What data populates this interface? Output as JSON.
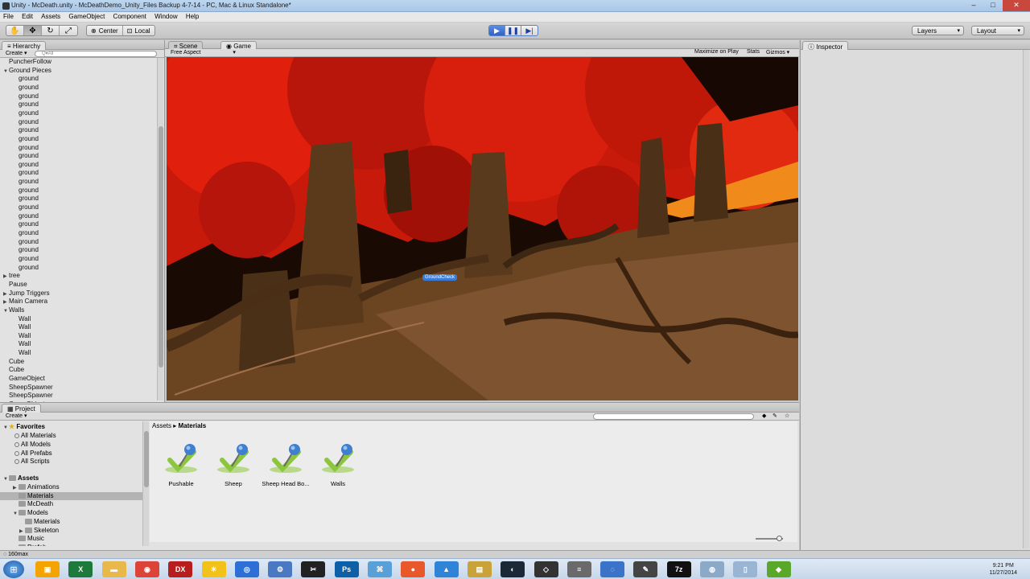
{
  "window": {
    "title": "Unity - McDeath.unity - McDeathDemo_Unity_Files Backup 4-7-14 - PC, Mac & Linux Standalone*",
    "minimize": "–",
    "maximize": "□",
    "close": "✕"
  },
  "menu": [
    "File",
    "Edit",
    "Assets",
    "GameObject",
    "Component",
    "Window",
    "Help"
  ],
  "toolbar": {
    "pivot": "Center",
    "space": "Local",
    "layers": "Layers",
    "layout": "Layout",
    "play_icon": "play-icon",
    "pause_icon": "pause-icon",
    "step_icon": "step-icon"
  },
  "hierarchy": {
    "tab": "Hierarchy",
    "create": "Create",
    "search_placeholder": "Q▾All",
    "items": [
      {
        "label": "PuncherFollow",
        "indent": 0,
        "arrow": ""
      },
      {
        "label": "Ground Pieces",
        "indent": 0,
        "arrow": "▼"
      },
      {
        "label": "ground",
        "indent": 1,
        "arrow": ""
      },
      {
        "label": "ground",
        "indent": 1,
        "arrow": ""
      },
      {
        "label": "ground",
        "indent": 1,
        "arrow": ""
      },
      {
        "label": "ground",
        "indent": 1,
        "arrow": ""
      },
      {
        "label": "ground",
        "indent": 1,
        "arrow": ""
      },
      {
        "label": "ground",
        "indent": 1,
        "arrow": ""
      },
      {
        "label": "ground",
        "indent": 1,
        "arrow": ""
      },
      {
        "label": "ground",
        "indent": 1,
        "arrow": ""
      },
      {
        "label": "ground",
        "indent": 1,
        "arrow": ""
      },
      {
        "label": "ground",
        "indent": 1,
        "arrow": ""
      },
      {
        "label": "ground",
        "indent": 1,
        "arrow": ""
      },
      {
        "label": "ground",
        "indent": 1,
        "arrow": ""
      },
      {
        "label": "ground",
        "indent": 1,
        "arrow": ""
      },
      {
        "label": "ground",
        "indent": 1,
        "arrow": ""
      },
      {
        "label": "ground",
        "indent": 1,
        "arrow": ""
      },
      {
        "label": "ground",
        "indent": 1,
        "arrow": ""
      },
      {
        "label": "ground",
        "indent": 1,
        "arrow": ""
      },
      {
        "label": "ground",
        "indent": 1,
        "arrow": ""
      },
      {
        "label": "ground",
        "indent": 1,
        "arrow": ""
      },
      {
        "label": "ground",
        "indent": 1,
        "arrow": ""
      },
      {
        "label": "ground",
        "indent": 1,
        "arrow": ""
      },
      {
        "label": "ground",
        "indent": 1,
        "arrow": ""
      },
      {
        "label": "ground",
        "indent": 1,
        "arrow": ""
      },
      {
        "label": "tree",
        "indent": 0,
        "arrow": "▶"
      },
      {
        "label": "Pause",
        "indent": 0,
        "arrow": ""
      },
      {
        "label": "Jump Triggers",
        "indent": 0,
        "arrow": "▶"
      },
      {
        "label": "Main Camera",
        "indent": 0,
        "arrow": "▶"
      },
      {
        "label": "Walls",
        "indent": 0,
        "arrow": "▼"
      },
      {
        "label": "Wall",
        "indent": 1,
        "arrow": ""
      },
      {
        "label": "Wall",
        "indent": 1,
        "arrow": ""
      },
      {
        "label": "Wall",
        "indent": 1,
        "arrow": ""
      },
      {
        "label": "Wall",
        "indent": 1,
        "arrow": ""
      },
      {
        "label": "Wall",
        "indent": 1,
        "arrow": ""
      },
      {
        "label": "Cube",
        "indent": 0,
        "arrow": ""
      },
      {
        "label": "Cube",
        "indent": 0,
        "arrow": ""
      },
      {
        "label": "GameObject",
        "indent": 0,
        "arrow": ""
      },
      {
        "label": "SheepSpawner",
        "indent": 0,
        "arrow": ""
      },
      {
        "label": "SheepSpawner",
        "indent": 0,
        "arrow": ""
      },
      {
        "label": "GameObject",
        "indent": 0,
        "arrow": ""
      }
    ]
  },
  "views": {
    "scene_tab": "Scene",
    "game_tab": "Game",
    "aspect": "Free Aspect",
    "maximize_on_play": "Maximize on Play",
    "stats": "Stats",
    "gizmos": "Gizmos",
    "object_label": "GroundCheck"
  },
  "inspector": {
    "tab": "Inspector"
  },
  "project": {
    "tab": "Project",
    "create": "Create",
    "favorites_header": "Favorites",
    "favorites": [
      "All Materials",
      "All Models",
      "All Prefabs",
      "All Scripts"
    ],
    "assets_header": "Assets",
    "tree": [
      {
        "label": "Animations",
        "indent": 1,
        "arrow": "▶",
        "selected": false
      },
      {
        "label": "Materials",
        "indent": 1,
        "arrow": "",
        "selected": true
      },
      {
        "label": "McDeath",
        "indent": 1,
        "arrow": "",
        "selected": false
      },
      {
        "label": "Models",
        "indent": 1,
        "arrow": "▼",
        "selected": false
      },
      {
        "label": "Materials",
        "indent": 2,
        "arrow": "",
        "selected": false
      },
      {
        "label": "Skeleton",
        "indent": 2,
        "arrow": "▶",
        "selected": false
      },
      {
        "label": "Music",
        "indent": 1,
        "arrow": "",
        "selected": false
      },
      {
        "label": "Prefab",
        "indent": 1,
        "arrow": "",
        "selected": false
      }
    ],
    "breadcrumb_root": "Assets",
    "breadcrumb_sep": "▸",
    "breadcrumb_current": "Materials",
    "assets": [
      "Pushable",
      "Sheep",
      "Sheep Head Bo...",
      "Walls"
    ]
  },
  "status": "160max",
  "taskbar": {
    "apps": [
      {
        "icon": "explorer-icon",
        "color": "#f4a300",
        "glyph": "▣"
      },
      {
        "icon": "excel-icon",
        "color": "#1e7a3a",
        "glyph": "X"
      },
      {
        "icon": "folder-icon",
        "color": "#e8b84a",
        "glyph": "▬"
      },
      {
        "icon": "chrome-icon",
        "color": "#db4437",
        "glyph": "◉"
      },
      {
        "icon": "dx-icon",
        "color": "#b81d1d",
        "glyph": "DX"
      },
      {
        "icon": "sun-icon",
        "color": "#f2c21b",
        "glyph": "☀"
      },
      {
        "icon": "globe-icon",
        "color": "#2d6fd6",
        "glyph": "◎"
      },
      {
        "icon": "gear-app-icon",
        "color": "#4a78c2",
        "glyph": "⚙"
      },
      {
        "icon": "tools-icon",
        "color": "#222222",
        "glyph": "✂"
      },
      {
        "icon": "photoshop-icon",
        "color": "#0d5fa8",
        "glyph": "Ps"
      },
      {
        "icon": "network-icon",
        "color": "#5aa0d8",
        "glyph": "⌘"
      },
      {
        "icon": "media-icon",
        "color": "#e9582b",
        "glyph": "●"
      },
      {
        "icon": "triangle-app-icon",
        "color": "#2f84d8",
        "glyph": "▲"
      },
      {
        "icon": "archive-icon",
        "color": "#caa23a",
        "glyph": "▤"
      },
      {
        "icon": "steam-icon",
        "color": "#1b2838",
        "glyph": "◐"
      },
      {
        "icon": "unity-icon",
        "color": "#333333",
        "glyph": "◇"
      },
      {
        "icon": "notepad-icon",
        "color": "#6a6a6a",
        "glyph": "≡"
      },
      {
        "icon": "browser-icon",
        "color": "#3b73c9",
        "glyph": "◌"
      },
      {
        "icon": "wrench-icon",
        "color": "#444444",
        "glyph": "✎"
      },
      {
        "icon": "sevenzip-icon",
        "color": "#111111",
        "glyph": "7z"
      },
      {
        "icon": "disk-icon",
        "color": "#8ca9c8",
        "glyph": "◍"
      },
      {
        "icon": "document-icon",
        "color": "#9ab4d4",
        "glyph": "▯"
      },
      {
        "icon": "nvidia-icon",
        "color": "#5aa82a",
        "glyph": "◆"
      }
    ],
    "time": "9:21 PM",
    "date": "11/27/2014"
  }
}
